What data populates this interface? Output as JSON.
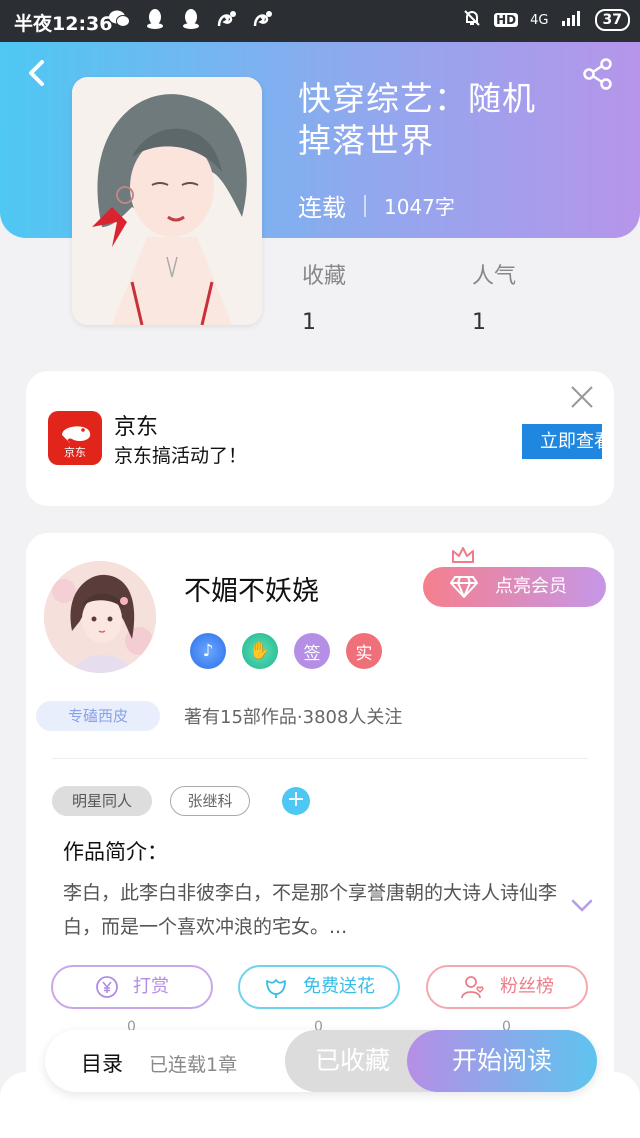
{
  "status_bar": {
    "time": "半夜12:36",
    "network": "4G",
    "hd": "HD",
    "battery": "37"
  },
  "book": {
    "title": "快穿综艺：随机掉落世界",
    "status": "连载",
    "word_count": "1047字",
    "stats": [
      {
        "label": "收藏",
        "value": "1"
      },
      {
        "label": "人气",
        "value": "1"
      }
    ]
  },
  "ad": {
    "app_name": "京东",
    "logo_text": "京东",
    "description": "京东搞活动了！",
    "button_label": "立即查看"
  },
  "author": {
    "name": "不媚不妖娆",
    "title_tag": "专磕西皮",
    "vip_button": "点亮会员",
    "badges": [
      "♪",
      "✋",
      "签",
      "实"
    ],
    "works_info": "著有15部作品·3808人关注"
  },
  "tags": [
    "明星同人",
    "张继科"
  ],
  "intro": {
    "heading": "作品简介：",
    "text": "李白，此李白非彼李白，不是那个享誉唐朝的大诗人诗仙李白，而是一个喜欢冲浪的宅女。..."
  },
  "actions": [
    {
      "label": "打赏",
      "count": "0",
      "icon": "yen-coin-icon"
    },
    {
      "label": "免费送花",
      "count": "0",
      "icon": "flower-icon"
    },
    {
      "label": "粉丝榜",
      "count": "0",
      "icon": "fan-user-icon"
    }
  ],
  "bottom_bar": {
    "toc_label": "目录",
    "toc_sub": "已连载1章",
    "favorited_label": "已收藏",
    "read_label": "开始阅读"
  },
  "colors": {
    "header_gradient_start": "#4ec8f2",
    "header_gradient_end": "#b695ea",
    "vip_gradient_start": "#f57f8d",
    "jd_red": "#e1251b",
    "ad_button_blue": "#1f87e0"
  }
}
